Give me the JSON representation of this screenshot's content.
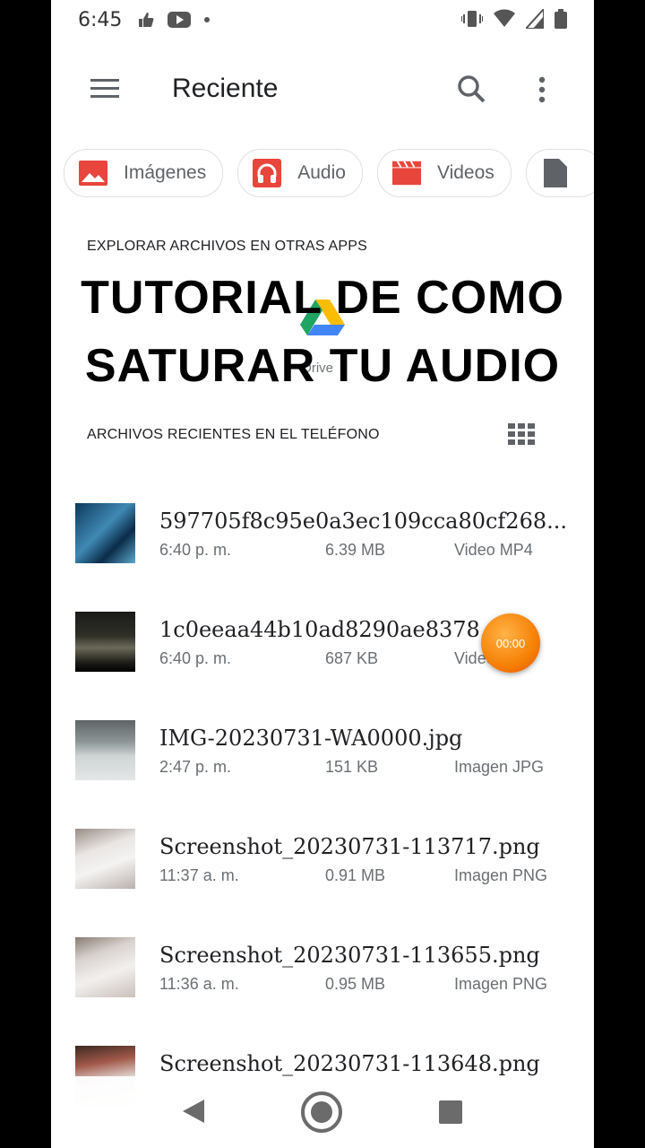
{
  "status": {
    "time": "6:45"
  },
  "appbar": {
    "title": "Reciente"
  },
  "chips": [
    {
      "label": "Imágenes",
      "icon": "image-icon",
      "color": "#e8453c"
    },
    {
      "label": "Audio",
      "icon": "headphones-icon",
      "color": "#e8453c"
    },
    {
      "label": "Videos",
      "icon": "clapperboard-icon",
      "color": "#e8453c"
    }
  ],
  "sections": {
    "explore": "EXPLORAR ARCHIVOS EN OTRAS APPS",
    "recent": "ARCHIVOS RECIENTES EN EL TELÉFONO"
  },
  "overlay": {
    "line1": "TUTORIAL DE COMO",
    "line2": "SATURAR TU AUDIO"
  },
  "apps": {
    "drive_label": "Drive"
  },
  "recorder": {
    "time": "00:00"
  },
  "files": [
    {
      "name": "597705f8c95e0a3ec109cca80cf268...",
      "time": "6:40 p. m.",
      "size": "6.39 MB",
      "type": "Video MP4"
    },
    {
      "name": "1c0eeaa44b10ad8290ae8378...",
      "time": "6:40 p. m.",
      "size": "687 KB",
      "type": "Video MP4"
    },
    {
      "name": "IMG-20230731-WA0000.jpg",
      "time": "2:47 p. m.",
      "size": "151 KB",
      "type": "Imagen JPG"
    },
    {
      "name": "Screenshot_20230731-113717.png",
      "time": "11:37 a. m.",
      "size": "0.91 MB",
      "type": "Imagen PNG"
    },
    {
      "name": "Screenshot_20230731-113655.png",
      "time": "11:36 a. m.",
      "size": "0.95 MB",
      "type": "Imagen PNG"
    },
    {
      "name": "Screenshot_20230731-113648.png",
      "time": "",
      "size": "",
      "type": ""
    }
  ]
}
